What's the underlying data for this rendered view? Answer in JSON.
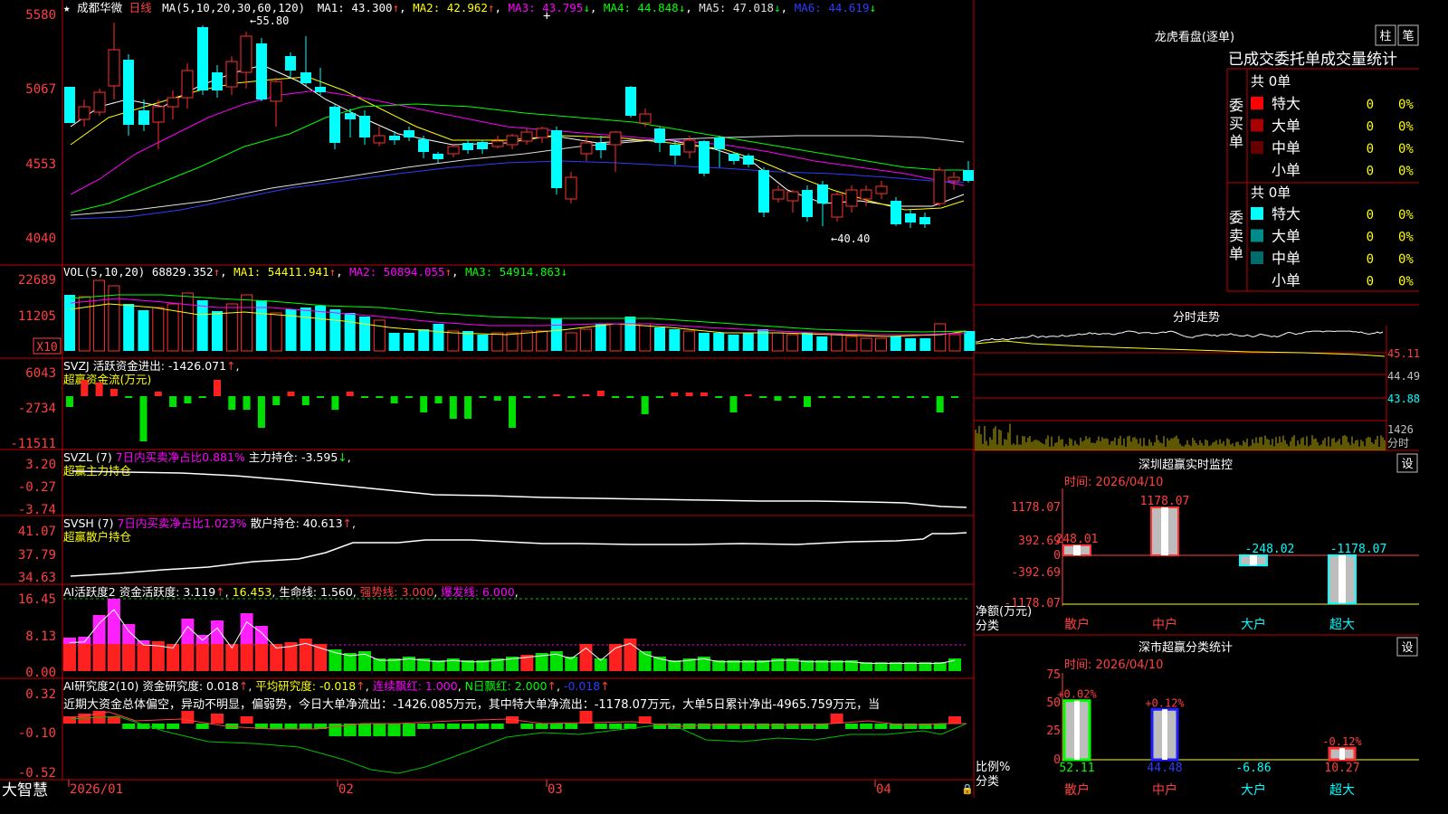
{
  "main": {
    "title_star": "★",
    "stock": "成都华微",
    "period": "日线",
    "ma_formula": "MA(5,10,20,30,60,120)",
    "ma": [
      {
        "label": "MA1: 43.300",
        "arrow": "↑",
        "color": "#ffffff"
      },
      {
        "label": "MA2: 42.962",
        "arrow": "↑",
        "color": "#ffff00"
      },
      {
        "label": "MA3: 43.795",
        "arrow": "↓",
        "color": "#ff00ff"
      },
      {
        "label": "MA4: 44.848",
        "arrow": "↓",
        "color": "#00ff00"
      },
      {
        "label": "MA5: 47.018",
        "arrow": "↓",
        "color": "#e0e0e0"
      },
      {
        "label": "MA6: 44.619",
        "arrow": "↓",
        "color": "#2d3cff"
      }
    ],
    "y_ticks": [
      "5580",
      "5067",
      "4553",
      "4040"
    ],
    "high_label": "55.80",
    "low_label": "40.40",
    "cross_mark": "+"
  },
  "vol": {
    "formula": "VOL(5,10,20)",
    "value": "68829.352",
    "ma1": "MA1: 54411.941",
    "ma2": "MA2: 50894.055",
    "ma3": "MA3: 54914.863",
    "y_ticks": [
      "22689",
      "11205"
    ],
    "unit": "X10"
  },
  "svzj": {
    "title": "SVZJ  活跃资金进出: -1426.071",
    "subtitle": "超赢资金流(万元)",
    "y_ticks": [
      "6043",
      "-2734",
      "-11511"
    ]
  },
  "svzl": {
    "title": "SVZL (7)",
    "ratio": "7日内买卖净占比0.881%",
    "hold": "主力持仓: -3.595",
    "subtitle": "超赢主力持仓",
    "y_ticks": [
      "3.20",
      "-0.27",
      "-3.74"
    ]
  },
  "svsh": {
    "title": "SVSH (7)",
    "ratio": "7日内买卖净占比1.023%",
    "hold": "散户持仓: 40.613",
    "subtitle": "超赢散户持仓",
    "y_ticks": [
      "41.07",
      "37.79",
      "34.63"
    ]
  },
  "ai_active": {
    "title": "AI活跃度2",
    "val1": "资金活跃度: 3.119",
    "val2": "16.453",
    "val3": "生命线: 1.560",
    "strong": "强势线: 3.000",
    "burst": "爆发线: 6.000",
    "y_ticks": [
      "16.45",
      "8.13",
      "0.00"
    ]
  },
  "ai_research": {
    "title": "AI研究度2(10)",
    "val1": "资金研究度: 0.018",
    "avg": "平均研究度: -0.018",
    "consec": "连续飘红: 1.000",
    "nday": "N日飘红: 2.000",
    "tail": "-0.018",
    "comment": "近期大资金总体偏空，异动不明显，偏弱势，今日大单净流出：-1426.085万元，其中特大单净流出：-1178.07万元，大单5日累计净出-4965.759万元，当",
    "y_ticks": [
      "0.32",
      "-0.10",
      "-0.52"
    ]
  },
  "xaxis": {
    "brand": "大智慧",
    "labels": [
      "2026/01",
      "02",
      "03",
      "04"
    ]
  },
  "right": {
    "top_title": "龙虎看盘(逐单)",
    "btn_zhu": "柱",
    "btn_bi": "笔",
    "section_title": "已成交委托单成交量统计",
    "buy_label": "委买单",
    "sell_label": "委卖单",
    "buy_total": "共 0单",
    "sell_total": "共 0单",
    "buy_rows": [
      {
        "name": "特大",
        "count": "0",
        "pct": "0%",
        "color": "#ff0000"
      },
      {
        "name": "大单",
        "count": "0",
        "pct": "0%",
        "color": "#aa0000"
      },
      {
        "name": "中单",
        "count": "0",
        "pct": "0%",
        "color": "#660000"
      },
      {
        "name": "小单",
        "count": "0",
        "pct": "0%",
        "color": "#000000"
      }
    ],
    "sell_rows": [
      {
        "name": "特大",
        "count": "0",
        "pct": "0%",
        "color": "#00ffff"
      },
      {
        "name": "大单",
        "count": "0",
        "pct": "0%",
        "color": "#008b8b"
      },
      {
        "name": "中单",
        "count": "0",
        "pct": "0%",
        "color": "#006b6b"
      },
      {
        "name": "小单",
        "count": "0",
        "pct": "0%",
        "color": "#000000"
      }
    ],
    "intraday_title": "分时走势",
    "intraday_prices": [
      "45.11",
      "44.49",
      "43.88"
    ],
    "intraday_vol": "1426",
    "intraday_vol_unit": "分时",
    "monitor_title": "深圳超赢实时监控",
    "monitor_btn": "设",
    "monitor_time": "时间: 2026/04/10",
    "monitor_y_ticks": [
      "1178.07",
      "392.69",
      "0",
      "-392.69",
      "-1178.07"
    ],
    "monitor_ylabel": "净额(万元)",
    "monitor_xlabel": "分类",
    "monitor_bars": [
      {
        "cat": "散户",
        "value": "248.01"
      },
      {
        "cat": "中户",
        "value": "1178.07"
      },
      {
        "cat": "大户",
        "value": "-248.02"
      },
      {
        "cat": "超大",
        "value": "-1178.07"
      }
    ],
    "class_title": "深市超赢分类统计",
    "class_btn": "设",
    "class_time": "时间: 2026/04/10",
    "class_y_ticks": [
      "75",
      "50",
      "25",
      "0"
    ],
    "class_ylabel": "比例%",
    "class_xlabel": "分类",
    "class_bars": [
      {
        "cat": "散户",
        "pct": "+0.02%",
        "value": "52.11"
      },
      {
        "cat": "中户",
        "pct": "+0.12%",
        "value": "44.48"
      },
      {
        "cat": "大户",
        "pct": "",
        "value": "-6.86"
      },
      {
        "cat": "超大",
        "pct": "-0.12%",
        "value": "10.27"
      }
    ]
  }
}
